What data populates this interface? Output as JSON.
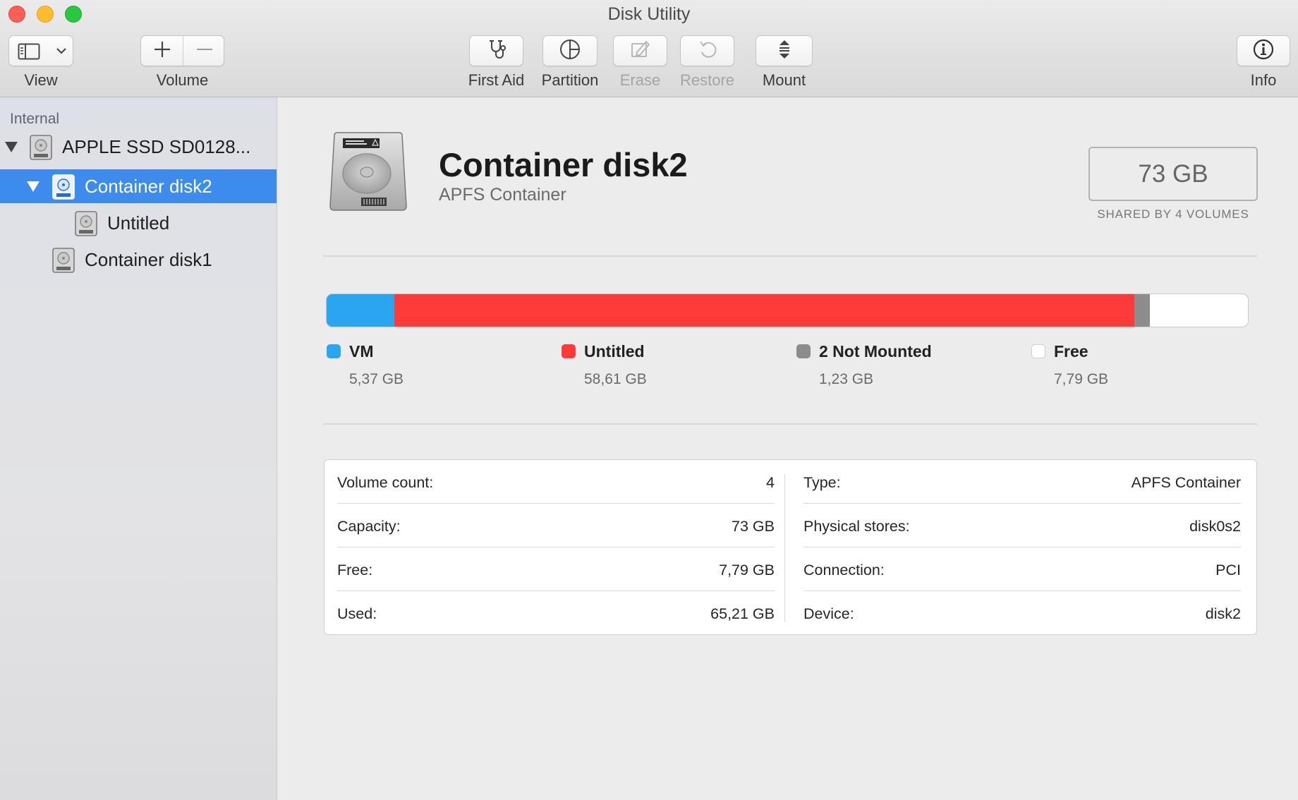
{
  "window": {
    "title": "Disk Utility"
  },
  "toolbar": {
    "view_label": "View",
    "volume_label": "Volume",
    "first_aid_label": "First Aid",
    "partition_label": "Partition",
    "erase_label": "Erase",
    "restore_label": "Restore",
    "mount_label": "Mount",
    "info_label": "Info"
  },
  "sidebar": {
    "section": "Internal",
    "items": [
      {
        "label": "APPLE SSD SD0128...",
        "icon": "hard-disk-icon",
        "expanded": true
      },
      {
        "label": "Container disk2",
        "icon": "container-disk-icon",
        "expanded": true,
        "selected": true
      },
      {
        "label": "Untitled",
        "icon": "volume-icon"
      },
      {
        "label": "Container disk1",
        "icon": "container-disk-icon"
      }
    ]
  },
  "header": {
    "title": "Container disk2",
    "subtitle": "APFS Container",
    "size": "73 GB",
    "size_caption": "SHARED BY 4 VOLUMES"
  },
  "usage": {
    "segments": [
      {
        "name": "VM",
        "value": "5,37 GB",
        "gb": 5.37,
        "color": "#2aa5ef"
      },
      {
        "name": "Untitled",
        "value": "58,61 GB",
        "gb": 58.61,
        "color": "#fe3b39"
      },
      {
        "name": "2 Not Mounted",
        "value": "1,23 GB",
        "gb": 1.23,
        "color": "#8c8c8c"
      },
      {
        "name": "Free",
        "value": "7,79 GB",
        "gb": 7.79,
        "color": "#ffffff"
      }
    ]
  },
  "info": {
    "left": [
      {
        "key": "Volume count:",
        "value": "4"
      },
      {
        "key": "Capacity:",
        "value": "73 GB"
      },
      {
        "key": "Free:",
        "value": "7,79 GB"
      },
      {
        "key": "Used:",
        "value": "65,21 GB"
      }
    ],
    "right": [
      {
        "key": "Type:",
        "value": "APFS Container"
      },
      {
        "key": "Physical stores:",
        "value": "disk0s2"
      },
      {
        "key": "Connection:",
        "value": "PCI"
      },
      {
        "key": "Device:",
        "value": "disk2"
      }
    ]
  }
}
